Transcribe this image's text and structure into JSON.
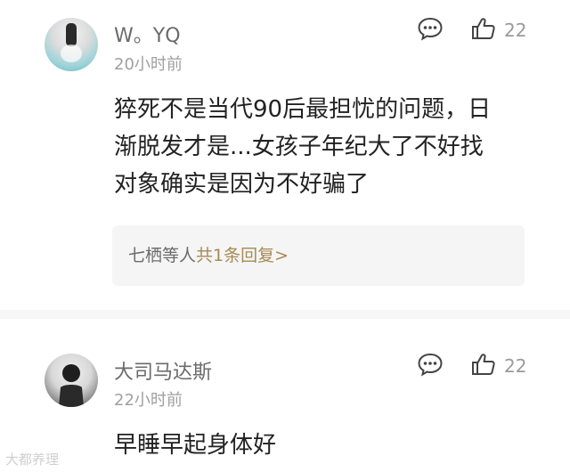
{
  "comments": [
    {
      "username": "W。YQ",
      "time": "20小时前",
      "likes": "22",
      "text_lines": [
        "猝死不是当代90后最担忧的问题，日",
        "渐脱发才是...女孩子年纪大了不好找",
        "对象确实是因为不好骗了"
      ],
      "reply_summary": {
        "names": "七栖等人",
        "link": "共1条回复>"
      },
      "icons": {
        "reply": "comment-bubble-icon",
        "like": "thumbs-up-icon",
        "avatar": "user-avatar"
      }
    },
    {
      "username": "大司马达斯",
      "time": "22小时前",
      "likes": "22",
      "text_lines": [
        "早睡早起身体好"
      ],
      "icons": {
        "reply": "comment-bubble-icon",
        "like": "thumbs-up-icon",
        "avatar": "user-avatar"
      }
    }
  ],
  "watermark": "大都养理",
  "colors": {
    "accent_link": "#a68a54",
    "username": "#6b6b6b",
    "meta": "#a0a0a0",
    "text": "#222222"
  }
}
